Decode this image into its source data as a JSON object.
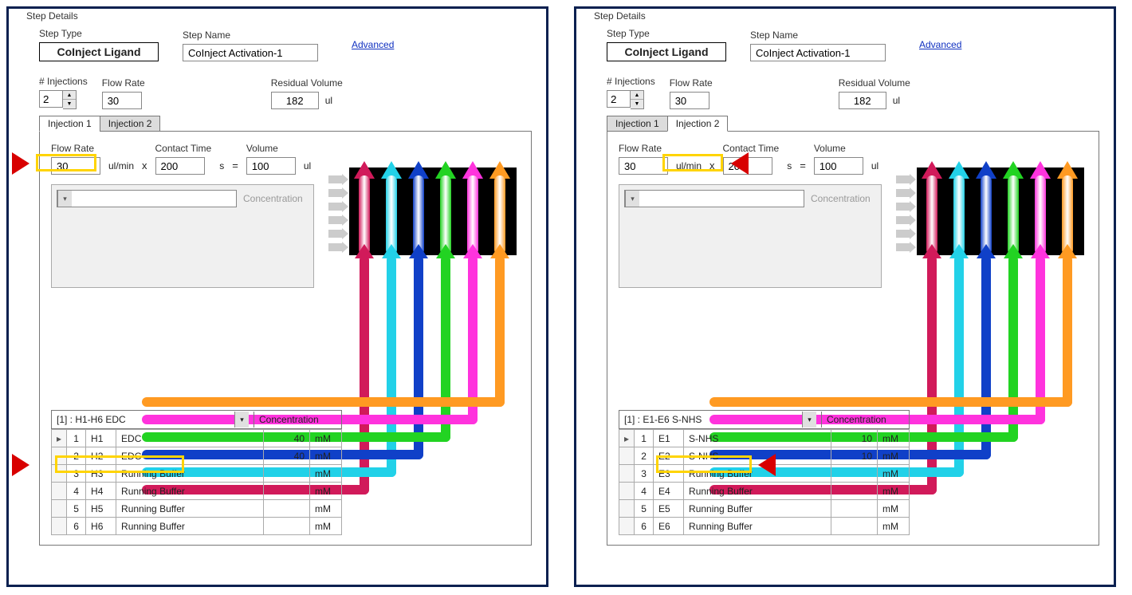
{
  "labels": {
    "fieldset": "Step Details",
    "stepType": "Step Type",
    "stepTypeValue": "CoInject Ligand",
    "stepName": "Step Name",
    "advanced": "Advanced",
    "injections": "# Injections",
    "flowRate": "Flow Rate",
    "residual": "Residual Volume",
    "ul": "ul",
    "ulmin": "ul/min",
    "x": "x",
    "s": "s",
    "eq": "=",
    "contact": "Contact Time",
    "volume": "Volume",
    "concentration": "Concentration",
    "mM": "mM"
  },
  "common": {
    "stepNameValue": "CoInject Activation-1",
    "injectionsValue": "2",
    "flowRateTop": "30",
    "residualValue": "182",
    "tabs": [
      "Injection 1",
      "Injection 2"
    ],
    "innerFlowRate": "30",
    "contactTime": "200",
    "volume": "100"
  },
  "colors": [
    "#d11a5a",
    "#22d1e8",
    "#1040c8",
    "#22d322",
    "#ff33dd",
    "#ff9a22"
  ],
  "left": {
    "activeTab": 0,
    "tableTitle": "[1] : H1-H6 EDC",
    "rows": [
      {
        "idx": "1",
        "well": "H1",
        "name": "EDC",
        "val": "40",
        "unit": "mM",
        "ind": "▸"
      },
      {
        "idx": "2",
        "well": "H2",
        "name": "EDC",
        "val": "40",
        "unit": "mM",
        "ind": ""
      },
      {
        "idx": "3",
        "well": "H3",
        "name": "Running Buffer",
        "val": "",
        "unit": "mM",
        "ind": ""
      },
      {
        "idx": "4",
        "well": "H4",
        "name": "Running Buffer",
        "val": "",
        "unit": "mM",
        "ind": ""
      },
      {
        "idx": "5",
        "well": "H5",
        "name": "Running Buffer",
        "val": "",
        "unit": "mM",
        "ind": ""
      },
      {
        "idx": "6",
        "well": "H6",
        "name": "Running Buffer",
        "val": "",
        "unit": "mM",
        "ind": ""
      }
    ]
  },
  "right": {
    "activeTab": 1,
    "tableTitle": "[1] : E1-E6 S-NHS",
    "rows": [
      {
        "idx": "1",
        "well": "E1",
        "name": "S-NHS",
        "val": "10",
        "unit": "mM",
        "ind": "▸"
      },
      {
        "idx": "2",
        "well": "E2",
        "name": "S-NHS",
        "val": "10",
        "unit": "mM",
        "ind": ""
      },
      {
        "idx": "3",
        "well": "E3",
        "name": "Running Buffer",
        "val": "",
        "unit": "mM",
        "ind": ""
      },
      {
        "idx": "4",
        "well": "E4",
        "name": "Running Buffer",
        "val": "",
        "unit": "mM",
        "ind": ""
      },
      {
        "idx": "5",
        "well": "E5",
        "name": "Running Buffer",
        "val": "",
        "unit": "mM",
        "ind": ""
      },
      {
        "idx": "6",
        "well": "E6",
        "name": "Running Buffer",
        "val": "",
        "unit": "mM",
        "ind": ""
      }
    ]
  }
}
